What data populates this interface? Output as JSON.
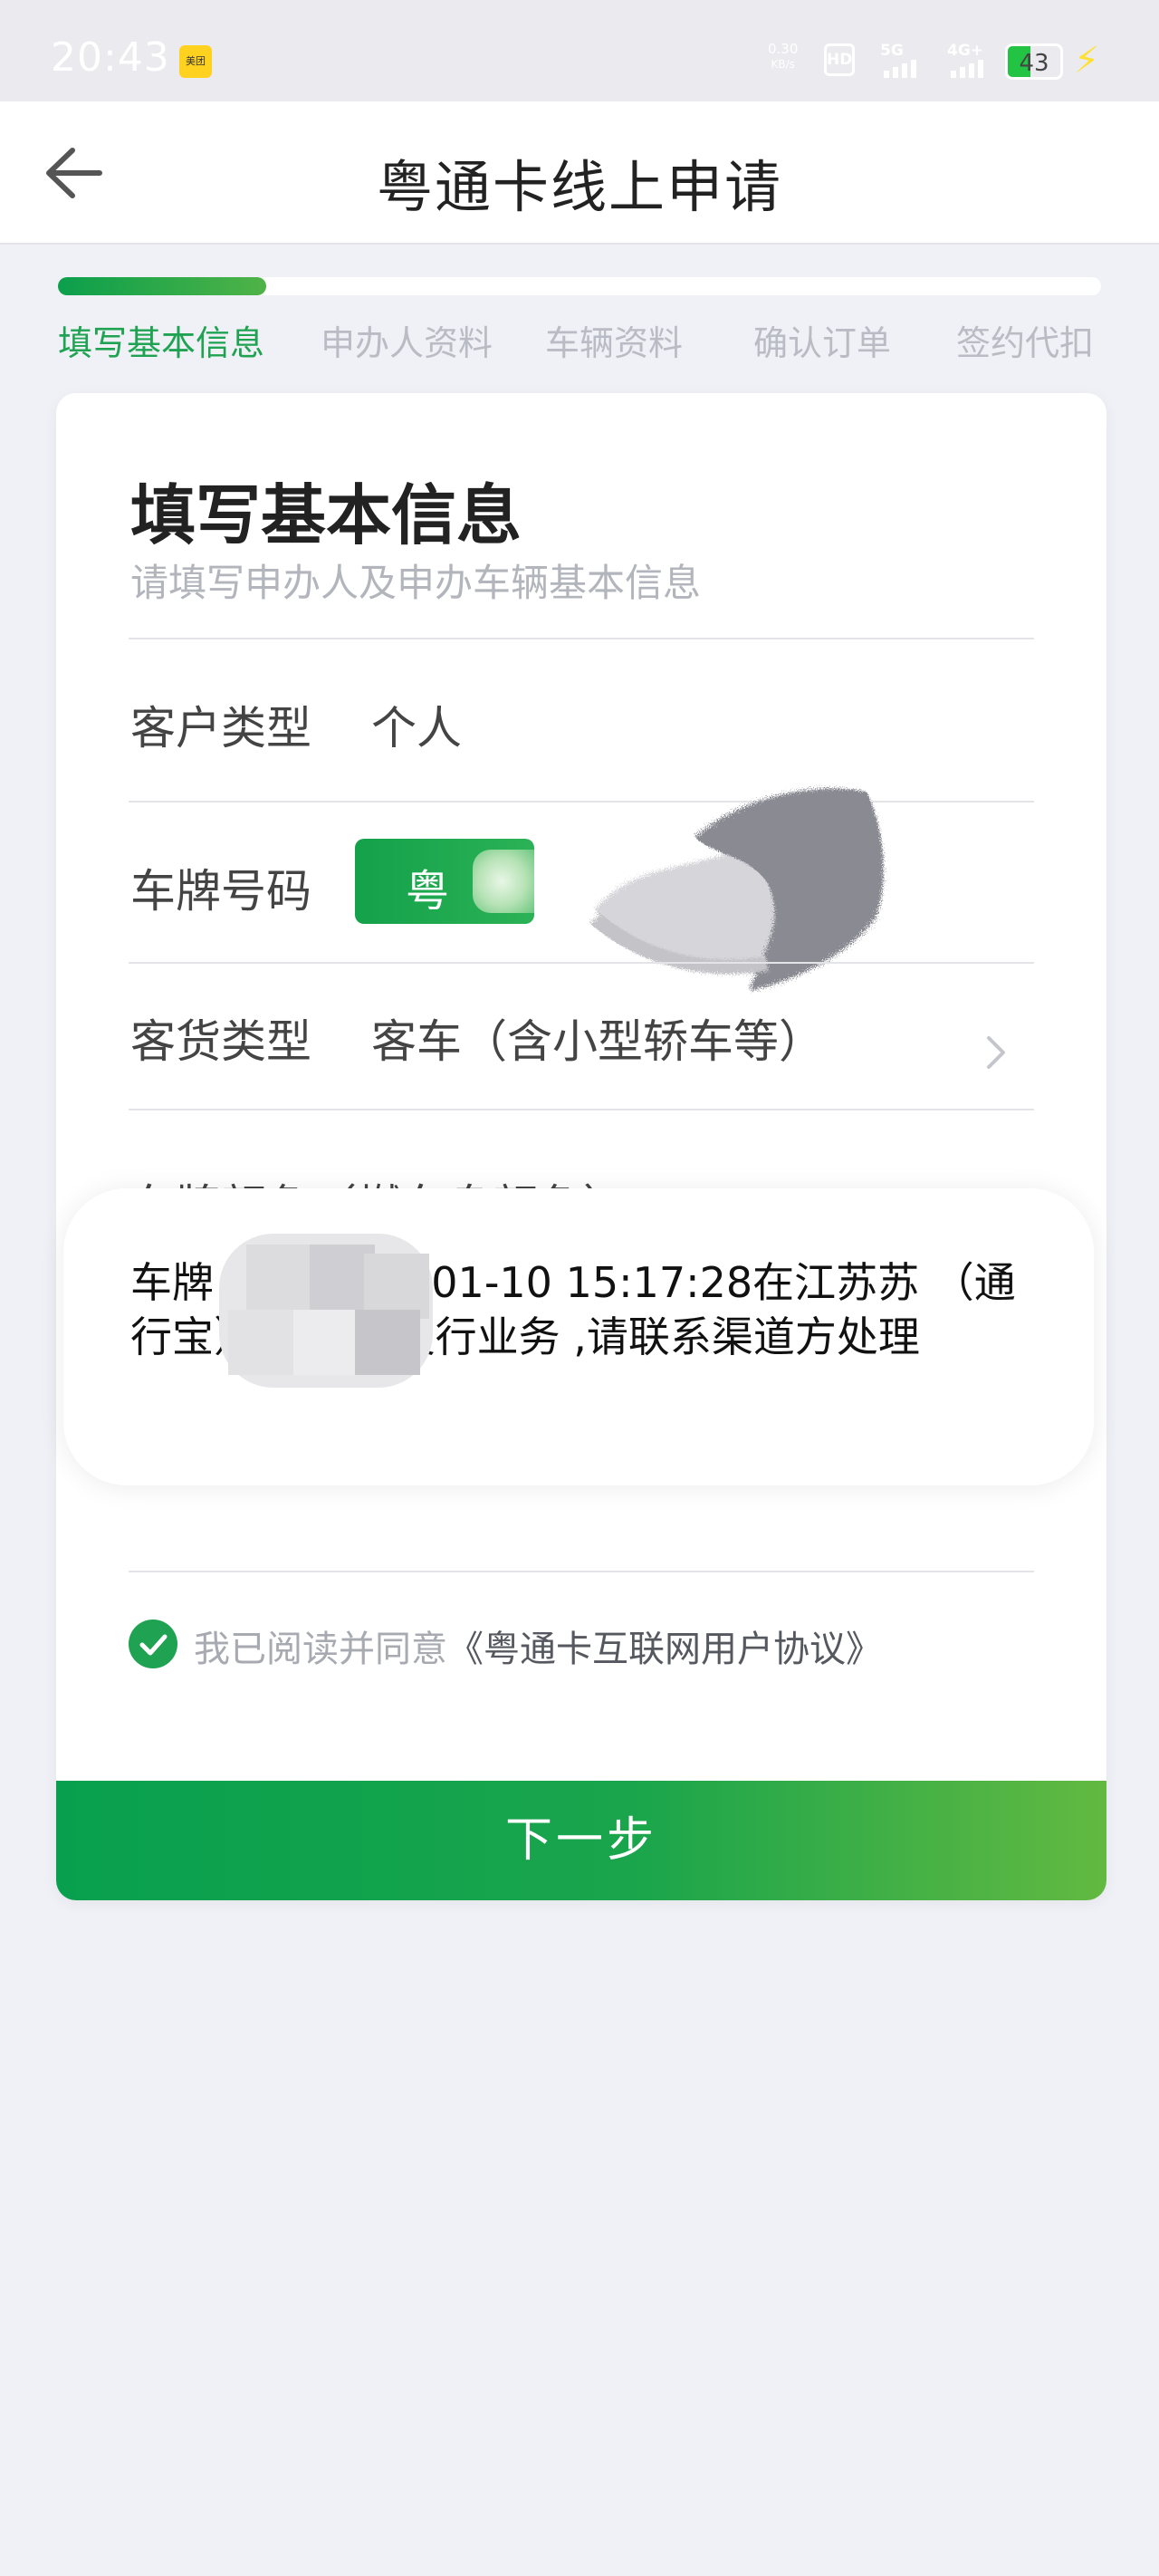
{
  "status_bar": {
    "time": "20:43",
    "app_icon_label": "美团",
    "network_speed_value": "0.30",
    "network_speed_unit": "KB/s",
    "hd_label": "HD",
    "sim1_label": "5G",
    "sim2_label": "4G+",
    "battery_level": "43",
    "battery_color": "#23c343"
  },
  "header": {
    "title": "粤通卡线上申请",
    "back_icon": "arrow-left-icon"
  },
  "progress": {
    "fraction": 0.2,
    "steps": [
      {
        "label": "填写基本信息",
        "active": true
      },
      {
        "label": "申办人资料",
        "active": false
      },
      {
        "label": "车辆资料",
        "active": false
      },
      {
        "label": "确认订单",
        "active": false
      },
      {
        "label": "签约代扣",
        "active": false
      }
    ]
  },
  "form": {
    "title": "填写基本信息",
    "subtitle": "请填写申办人及申办车辆基本信息",
    "customer_type": {
      "label": "客户类型",
      "value": "个人"
    },
    "plate_number": {
      "label": "车牌号码",
      "province": "粤"
    },
    "cargo_type": {
      "label": "客货类型",
      "value": "客车（含小型轿车等）"
    },
    "plate_color": {
      "label": "车牌颜色（燃车身颜色）",
      "options": [
        "black",
        "yellow-green",
        "white"
      ]
    },
    "agreement": {
      "prefix": "我已阅读并同意",
      "link": "《粤通卡互联网用户协议》",
      "checked": true
    }
  },
  "next_button": {
    "label": "下一步"
  },
  "toast": {
    "message": "车牌        已在2019-01-10  15:17:28在江苏苏 （通行宝）,办理过发行业务 ,请联系渠道方处理"
  },
  "colors": {
    "accent": "#1fa352",
    "button_start": "#08a04e",
    "button_end": "#62b941",
    "background": "#f0f1f6"
  }
}
